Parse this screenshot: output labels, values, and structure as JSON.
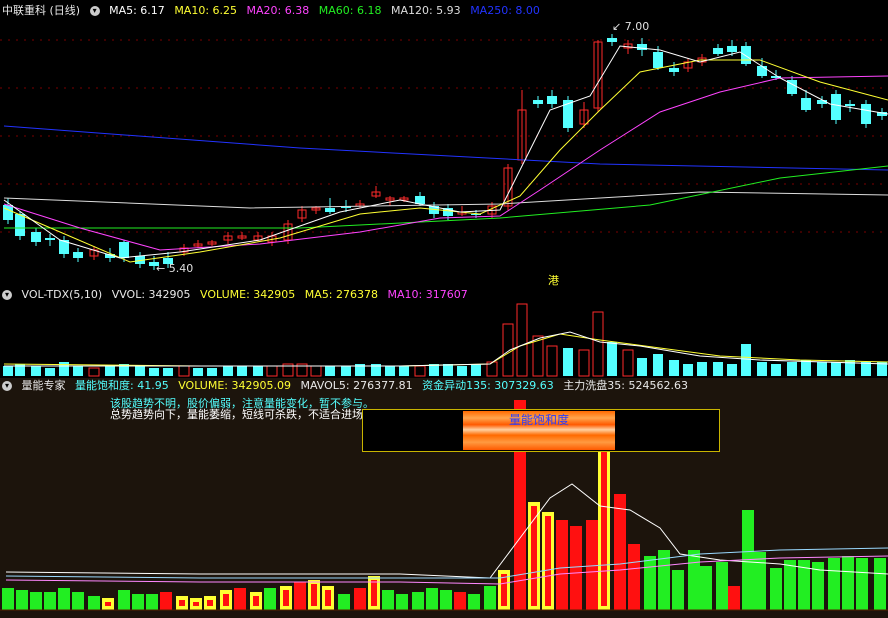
{
  "colors": {
    "up": "#ff2a2a",
    "down": "#54ffff",
    "ma5": "#ffffff",
    "ma10": "#ffff33",
    "ma20": "#ff44ff",
    "ma60": "#22ee22",
    "ma120": "#dddddd",
    "ma250": "#2233ff",
    "vol_down": "#54ffff",
    "energy_red": "#ff1010",
    "energy_yellow": "#ffff33",
    "energy_green": "#22ee22"
  },
  "main": {
    "stock_name": "中联重科 (日线)",
    "collapse_icon": "chevron-down-icon",
    "ma5": "MA5: 6.17",
    "ma10": "MA10: 6.25",
    "ma20": "MA20: 6.38",
    "ma60": "MA60: 6.18",
    "ma120": "MA120: 5.93",
    "ma250": "MA250: 8.00",
    "high_label": "7.00",
    "low_label": "5.40",
    "hk_marker": "港"
  },
  "volume": {
    "indicator": "VOL-TDX(5,10)",
    "vvol": "VVOL: 342905",
    "volume": "VOLUME: 342905",
    "ma5": "MA5: 276378",
    "ma10": "MA10: 317607"
  },
  "energy": {
    "name": "量能专家",
    "saturation": "量能饱和度: 41.95",
    "volume": "VOLUME: 342905.09",
    "mavol5": "MAVOL5: 276377.81",
    "fund_move": "资金异动135: 307329.63",
    "washout": "主力洗盘35: 524562.63",
    "note_line1": "该股趋势不明，股价偏弱，注意量能变化，暂不参与。",
    "note_line2": "总势趋势向下，量能萎缩，短线可杀跌，不适合进场。",
    "box_title": "量能饱和度"
  }
}
